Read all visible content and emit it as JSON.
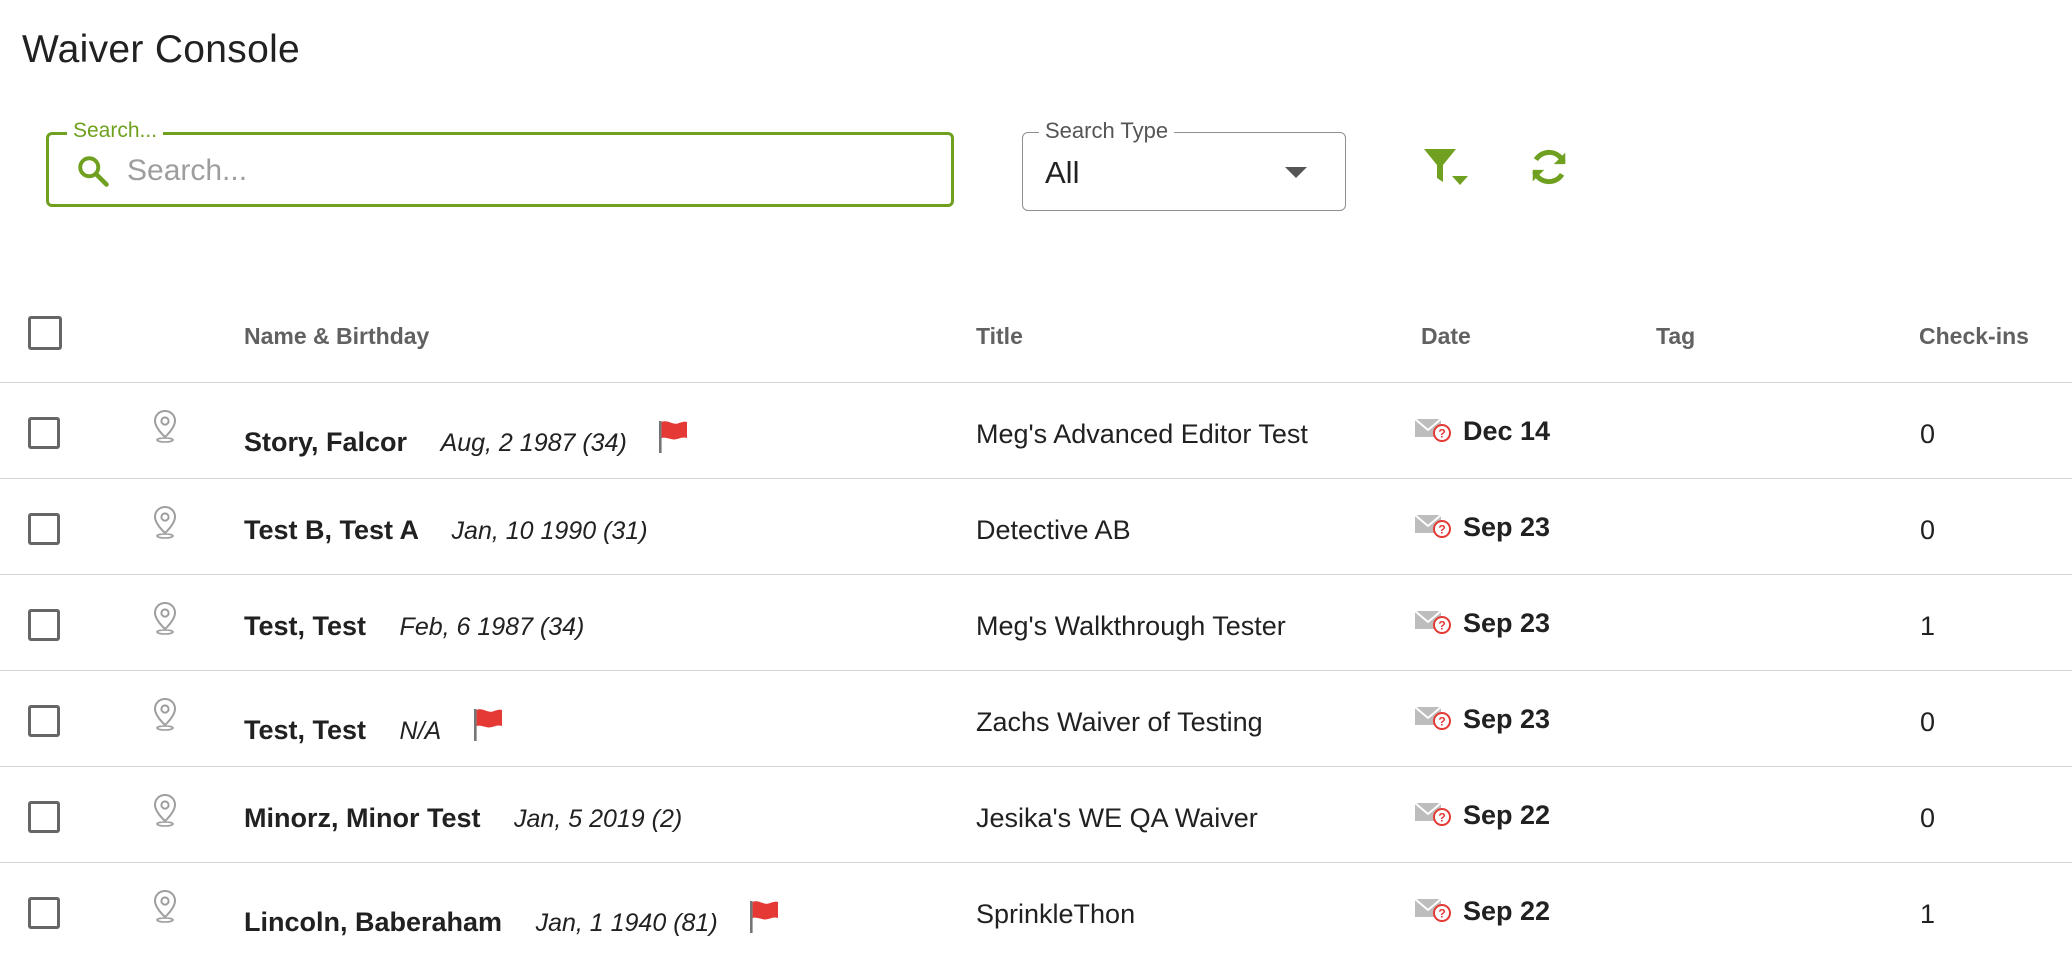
{
  "header": {
    "title": "Waiver Console"
  },
  "search": {
    "label": "Search...",
    "placeholder": "Search..."
  },
  "search_type": {
    "label": "Search Type",
    "value": "All"
  },
  "colors": {
    "accent": "#6fa01f",
    "flag": "#e53935",
    "mail_badge": "#e53935"
  },
  "table": {
    "columns": {
      "name": "Name & Birthday",
      "title": "Title",
      "date": "Date",
      "tag": "Tag",
      "checkins": "Check-ins"
    },
    "rows": [
      {
        "name": "Story, Falcor",
        "birthday": "Aug, 2 1987 (34)",
        "flagged": true,
        "title": "Meg's Advanced Editor Test",
        "date": "Dec 14",
        "tag": "",
        "checkins": "0"
      },
      {
        "name": "Test B, Test A",
        "birthday": "Jan, 10 1990 (31)",
        "flagged": false,
        "title": "Detective AB",
        "date": "Sep 23",
        "tag": "",
        "checkins": "0"
      },
      {
        "name": "Test, Test",
        "birthday": "Feb, 6 1987 (34)",
        "flagged": false,
        "title": "Meg's Walkthrough Tester",
        "date": "Sep 23",
        "tag": "",
        "checkins": "1"
      },
      {
        "name": "Test, Test",
        "birthday": "N/A",
        "flagged": true,
        "title": "Zachs Waiver of Testing",
        "date": "Sep 23",
        "tag": "",
        "checkins": "0"
      },
      {
        "name": "Minorz, Minor Test",
        "birthday": "Jan, 5 2019 (2)",
        "flagged": false,
        "title": "Jesika's WE QA Waiver",
        "date": "Sep 22",
        "tag": "",
        "checkins": "0"
      },
      {
        "name": "Lincoln, Baberaham",
        "birthday": "Jan, 1 1940 (81)",
        "flagged": true,
        "title": "SprinkleThon",
        "date": "Sep 22",
        "tag": "",
        "checkins": "1"
      }
    ]
  },
  "icons": {
    "search": "search-icon",
    "filter": "filter-icon",
    "refresh": "refresh-icon",
    "location": "location-pin-icon",
    "flag": "flag-icon",
    "mail_status": "mail-unknown-icon"
  }
}
